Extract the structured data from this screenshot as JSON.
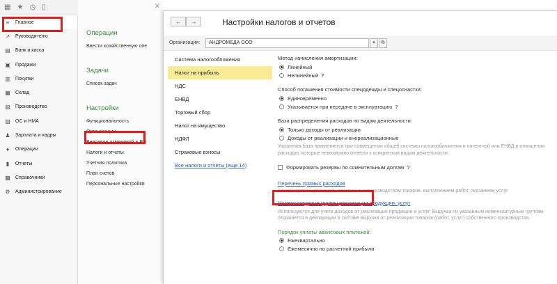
{
  "sections": [
    {
      "label": "Главное",
      "icon": "menu-lines-icon",
      "glyph": "≡"
    },
    {
      "label": "Руководителю",
      "icon": "trend-icon",
      "glyph": "↗"
    },
    {
      "label": "Банк и касса",
      "icon": "bank-icon",
      "glyph": "▤"
    },
    {
      "label": "Продажи",
      "icon": "bag-icon",
      "glyph": "▣"
    },
    {
      "label": "Покупки",
      "icon": "cart-icon",
      "glyph": "▥"
    },
    {
      "label": "Склад",
      "icon": "warehouse-icon",
      "glyph": "▦"
    },
    {
      "label": "Производство",
      "icon": "factory-icon",
      "glyph": "▧"
    },
    {
      "label": "ОС и НМА",
      "icon": "assets-icon",
      "glyph": "▨"
    },
    {
      "label": "Зарплата и кадры",
      "icon": "people-icon",
      "glyph": "♟"
    },
    {
      "label": "Операции",
      "icon": "operations-icon",
      "glyph": "♦"
    },
    {
      "label": "Отчеты",
      "icon": "reports-icon",
      "glyph": "▮"
    },
    {
      "label": "Справочники",
      "icon": "catalog-icon",
      "glyph": "▩"
    },
    {
      "label": "Администрирование",
      "icon": "gear-icon",
      "glyph": "⚙"
    }
  ],
  "toolbar": {
    "icons": [
      "apps-icon",
      "star-icon",
      "history-icon",
      "bookmark-icon"
    ]
  },
  "nav": {
    "operations": {
      "heading": "Операции",
      "links": [
        "Ввести хозяйственную опе"
      ]
    },
    "tasks": {
      "heading": "Задачи",
      "links": [
        "Список задач"
      ]
    },
    "settings": {
      "heading": "Настройки",
      "links": [
        "Функциональность",
        "Организации",
        "Внесение изменений в ЕП",
        "Налоги и отчеты",
        "Учетная политика",
        "План счетов",
        "Персональные настройки"
      ]
    }
  },
  "form": {
    "title": "Настройки налогов и отчетов",
    "org_label": "Организация:",
    "org_value": "АНДРОМЕДА ООО",
    "tax_list": [
      "Система налогообложения",
      "Налог на прибыль",
      "НДС",
      "ЕНВД",
      "Торговый сбор",
      "Налог на имущество",
      "НДФЛ",
      "Страховые взносы"
    ],
    "all_taxes_link": "Все налоги и отчеты (еще 14)",
    "amort_label": "Метод начисления амортизации:",
    "amort_options": [
      "Линейный",
      "Нелинейный"
    ],
    "overalls_label": "Способ погашения стоимости спецодежды и спецоснастки:",
    "overalls_options": [
      "Единовременно",
      "Указывается при передаче в эксплуатацию"
    ],
    "expense_label": "База распределения расходов по видам деятельности:",
    "expense_options": [
      "Только доходы от реализации",
      "Доходы от реализации и внереализационные"
    ],
    "expense_note": "Указанная база применяется при совмещении общей системы налогообложения и патентной или ЕНВД в отношении расходов, которые невозможно отнести к конкретным видам деятельности.",
    "reserves_label": "Формировать резервы по сомнительным долгам",
    "direct_link": "Перечень прямых расходов",
    "direct_note": "Список прямых расходов, связанных с производством товаров, выполнением работ, оказанием услуг",
    "groups_link": "Номенклатурные группы реализации продукции, услуг",
    "groups_note": "Используются для учета доходов от реализации продукции и услуг. Выручка по указанным номенклатурным группам отражается в декларации в составе выручки от реализации товаров (работ, услуг) собственного производства.",
    "advance_label": "Порядок уплаты авансовых платежей:",
    "advance_options": [
      "Ежеквартально",
      "Ежемесячно по расчетной прибыли"
    ]
  },
  "colors": {
    "highlight_red": "#e31c1c",
    "selected_row": "#fbeb94",
    "heading_green": "#3a8a3a",
    "link_blue": "#2a5db0"
  }
}
